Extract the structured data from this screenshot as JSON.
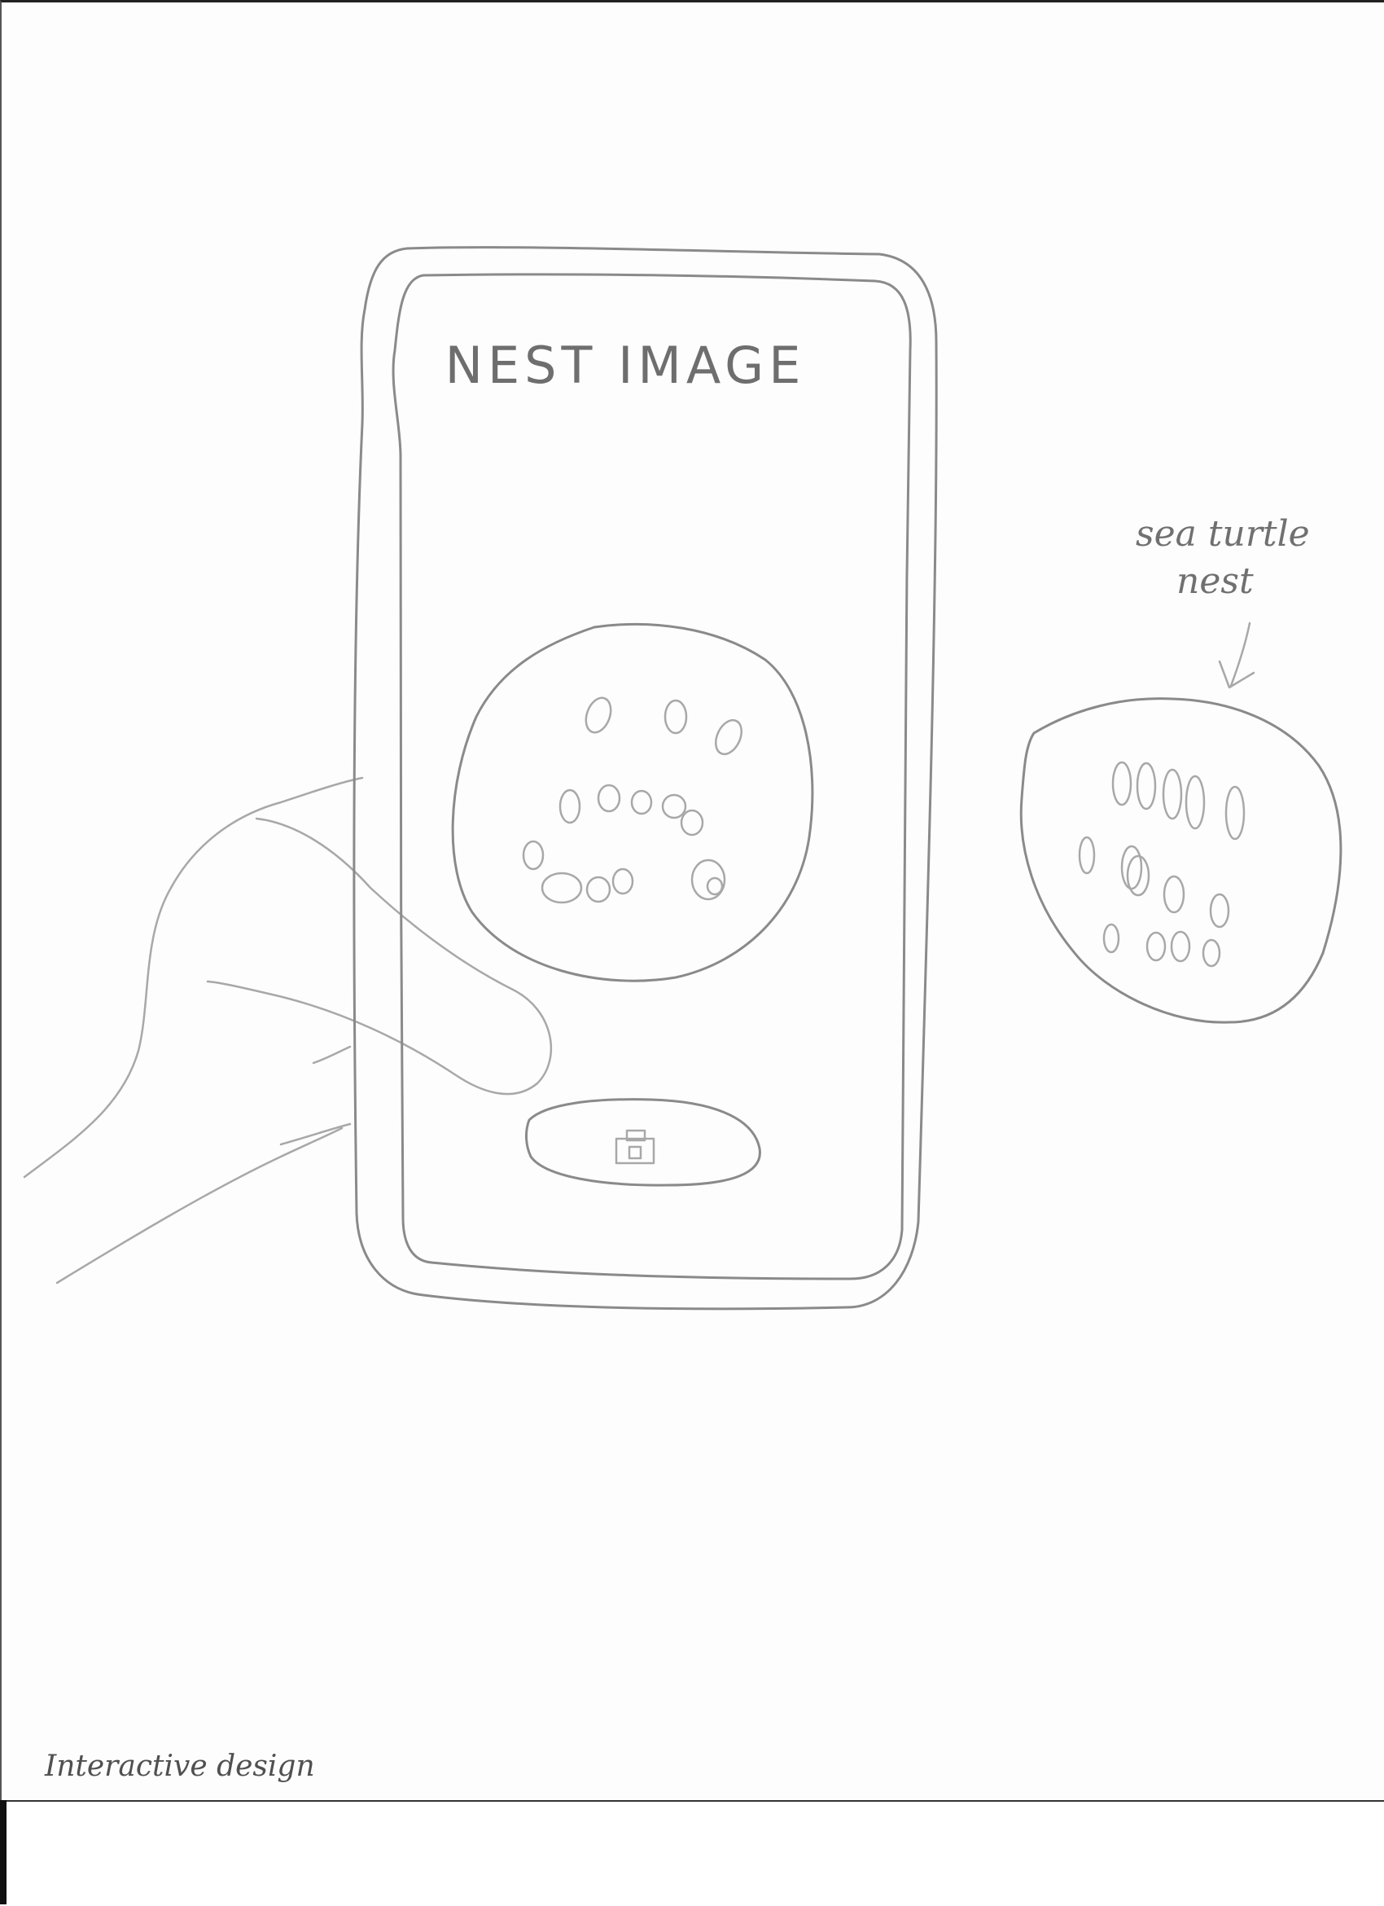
{
  "screen": {
    "title": "NEST IMAGE",
    "camera_button_icon": "camera-icon"
  },
  "annotation": {
    "line1": "sea turtle",
    "line2": "nest",
    "arrow_icon": "arrow-down-icon"
  },
  "footer": {
    "label": "Interactive design"
  },
  "colors": {
    "pencil": "#8a8a8a",
    "paper": "#fdfdfd",
    "ink_dark": "#505050"
  }
}
